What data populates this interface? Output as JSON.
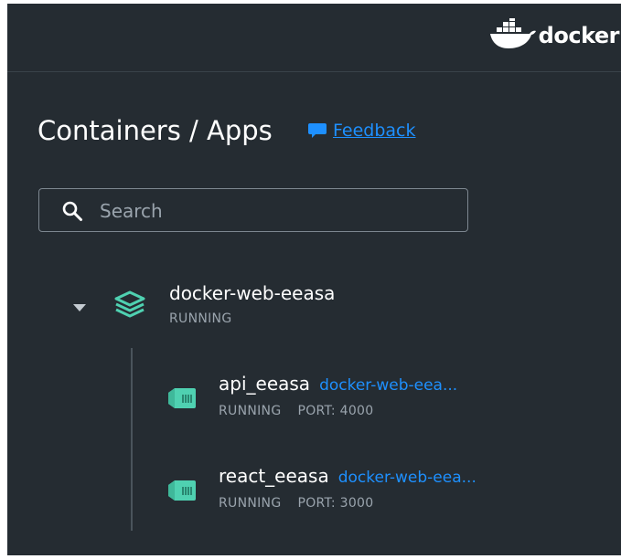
{
  "header": {
    "brand": "docker"
  },
  "page": {
    "title": "Containers / Apps",
    "feedback_label": "Feedback"
  },
  "search": {
    "placeholder": "Search",
    "value": ""
  },
  "app": {
    "name": "docker-web-eeasa",
    "status": "RUNNING",
    "expanded": true
  },
  "containers": [
    {
      "name": "api_eeasa",
      "app_link": "docker-web-eea...",
      "status": "RUNNING",
      "port": "PORT: 4000"
    },
    {
      "name": "react_eeasa",
      "app_link": "docker-web-eea...",
      "status": "RUNNING",
      "port": "PORT: 3000"
    }
  ],
  "colors": {
    "background": "#252c32",
    "accent": "#1e90ff",
    "container_icon": "#4fd1b1",
    "muted_text": "#9aa4ad"
  }
}
